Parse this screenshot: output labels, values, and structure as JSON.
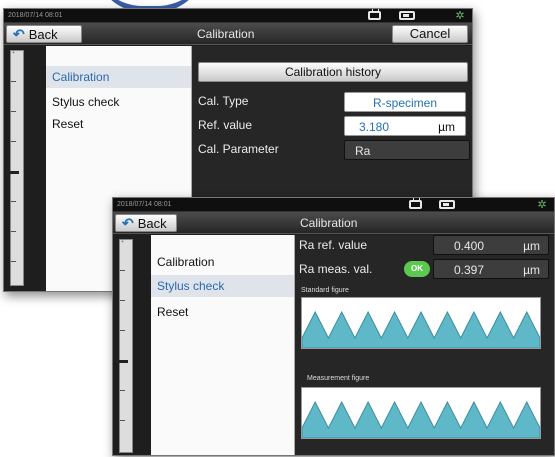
{
  "screen_back": {
    "status_time": "2018/07/14 08:01",
    "back_label": "Back",
    "title": "Calibration",
    "cancel_label": "Cancel",
    "menu": [
      {
        "label": "Calibration",
        "active": true
      },
      {
        "label": "Stylus check",
        "active": false
      },
      {
        "label": "Reset",
        "active": false
      }
    ],
    "history_button": "Calibration history",
    "cal_type": {
      "label": "Cal. Type",
      "value": "R-specimen"
    },
    "ref_value": {
      "label": "Ref. value",
      "value": "3.180",
      "unit": "µm"
    },
    "cal_parameter": {
      "label": "Cal. Parameter",
      "value": "Ra"
    }
  },
  "screen_front": {
    "status_time": "2018/07/14 08:01",
    "back_label": "Back",
    "title": "Calibration",
    "menu": [
      {
        "label": "Calibration",
        "active": false
      },
      {
        "label": "Stylus check",
        "active": true
      },
      {
        "label": "Reset",
        "active": false
      }
    ],
    "ra_ref": {
      "label": "Ra ref. value",
      "value": "0.400",
      "unit": "µm"
    },
    "ra_meas": {
      "label": "Ra meas. val.",
      "value": "0.397",
      "unit": "µm",
      "status": "OK"
    },
    "standard_figure_label": "Standard figure",
    "measurement_figure_label": "Measurement figure"
  },
  "colors": {
    "accent_blue": "#2572b3",
    "ok_green": "#5dc850",
    "wave_fill": "#5fb8c8"
  }
}
